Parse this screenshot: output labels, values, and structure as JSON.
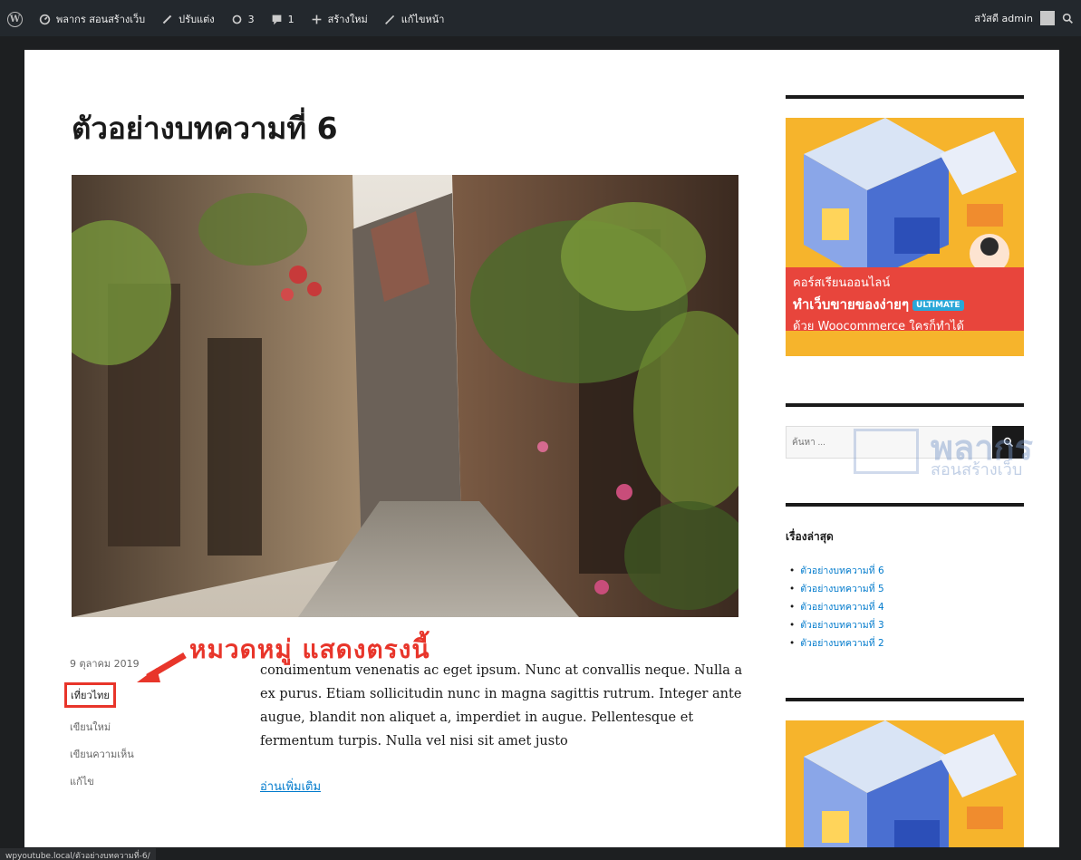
{
  "adminbar": {
    "site_name": "พลากร สอนสร้างเว็บ",
    "customize": "ปรับแต่ง",
    "updates_count": "3",
    "comments_count": "1",
    "new_label": "สร้างใหม่",
    "edit_label": "แก้ไขหน้า",
    "greeting": "สวัสดี admin"
  },
  "post": {
    "title": "ตัวอย่างบทความที่ 6",
    "date": "9 ตุลาคม 2019",
    "category": "เที่ยวไทย",
    "new_label": "เขียนใหม่",
    "comment_label": "เขียนความเห็น",
    "edit_label": "แก้ไข",
    "excerpt": "condimentum venenatis ac eget ipsum. Nunc at convallis neque. Nulla a ex purus. Etiam sollicitudin nunc in magna sagittis rutrum. Integer ante augue, blandit non aliquet a, imperdiet in augue. Pellentesque et fermentum turpis. Nulla vel nisi sit amet justo",
    "read_more": "อ่านเพิ่มเติม"
  },
  "annotation": {
    "callout": "หมวดหมู่ แสดงตรงนี้",
    "color": "#e8352a"
  },
  "sidebar": {
    "banner": {
      "line1": "คอร์สเรียนออนไลน์",
      "line2": "ทำเว็บขายของง่ายๆ",
      "badge": "ULTIMATE",
      "line3": "ด้วย Woocommerce ใครก็ทำได้"
    },
    "search_placeholder": "ค้นหา ...",
    "watermark_top": "พลากร",
    "watermark_bottom": "สอนสร้างเว็บ",
    "recent_title": "เรื่องล่าสุด",
    "recent": [
      "ตัวอย่างบทความที่ 6",
      "ตัวอย่างบทความที่ 5",
      "ตัวอย่างบทความที่ 4",
      "ตัวอย่างบทความที่ 3",
      "ตัวอย่างบทความที่ 2"
    ]
  },
  "statusbar": {
    "url": "wpyoutube.local/ตัวอย่างบทความที่-6/"
  },
  "colors": {
    "link": "#007acc",
    "adminbar": "#23282d",
    "banner": "#e8453c"
  }
}
